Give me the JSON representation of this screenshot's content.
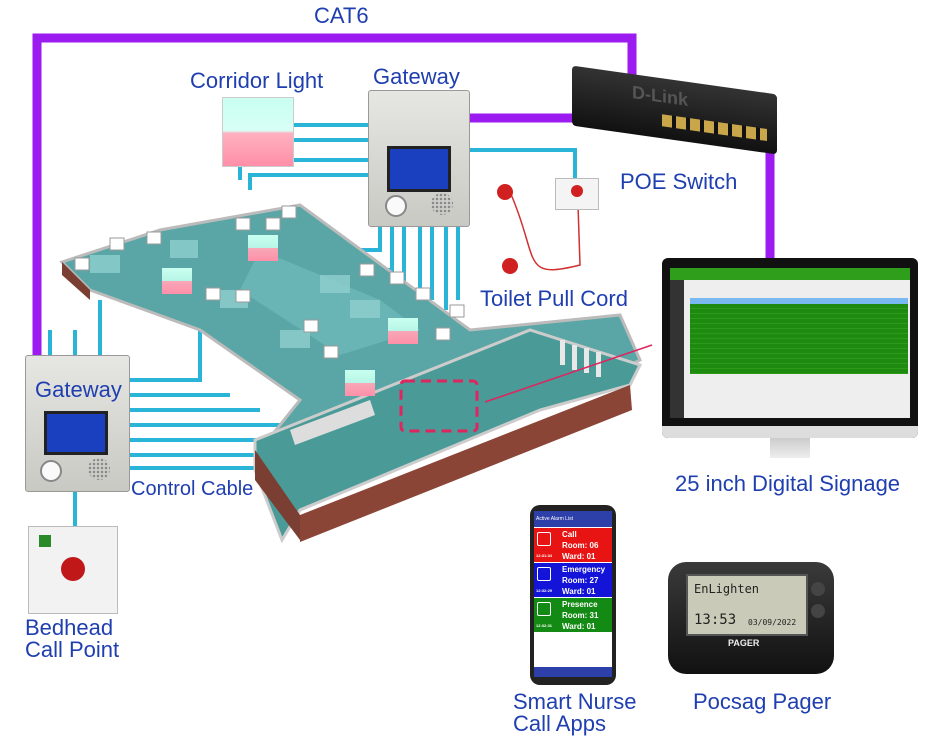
{
  "labels": {
    "cat6": "CAT6",
    "corridor_light": "Corridor Light",
    "gateway_top": "Gateway",
    "poe_switch": "POE Switch",
    "toilet_pull_cord": "Toilet Pull Cord",
    "gateway_left": "Gateway",
    "control_cable": "Control Cable",
    "digital_signage": "25 inch Digital Signage",
    "bedhead_line1": "Bedhead",
    "bedhead_line2": "Call Point",
    "apps_line1": "Smart Nurse",
    "apps_line2": "Call Apps",
    "pager": "Pocsag Pager"
  },
  "colors": {
    "cat6": "#9b1bf0",
    "control_cable": "#2ab4d8",
    "label": "#1f3fb0",
    "highlight": "#e0245e"
  },
  "phone": {
    "header": "Active Alarm List",
    "alarms": [
      {
        "type": "Call",
        "room": "Room: 06",
        "ward": "Ward: 01",
        "time": "12:31:34",
        "color": "#e81414"
      },
      {
        "type": "Emergency",
        "room": "Room: 27",
        "ward": "Ward: 01",
        "time": "12:32:29",
        "color": "#1414d8"
      },
      {
        "type": "Presence",
        "room": "Room: 31",
        "ward": "Ward: 01",
        "time": "12:32:31",
        "color": "#138a13"
      }
    ]
  },
  "pager": {
    "message": "EnLighten",
    "time": "13:53",
    "date": "03/09/2022",
    "brand": "PAGER"
  },
  "switch": {
    "brand": "D-Link"
  }
}
